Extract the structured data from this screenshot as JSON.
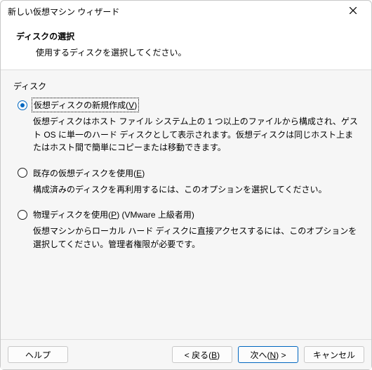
{
  "window": {
    "title": "新しい仮想マシン ウィザード"
  },
  "header": {
    "heading": "ディスクの選択",
    "subheading": "使用するディスクを選択してください。"
  },
  "group": {
    "label": "ディスク"
  },
  "options": [
    {
      "label_pre": "仮想ディスクの新規作成(",
      "accel": "V",
      "label_post": ")",
      "desc": "仮想ディスクはホスト ファイル システム上の 1 つ以上のファイルから構成され、ゲスト OS に単一のハード ディスクとして表示されます。仮想ディスクは同じホスト上またはホスト間で簡単にコピーまたは移動できます。",
      "checked": true
    },
    {
      "label_pre": "既存の仮想ディスクを使用(",
      "accel": "E",
      "label_post": ")",
      "desc": "構成済みのディスクを再利用するには、このオプションを選択してください。",
      "checked": false
    },
    {
      "label_pre": "物理ディスクを使用(",
      "accel": "P",
      "label_post": ") (VMware 上級者用)",
      "desc": "仮想マシンからローカル ハード ディスクに直接アクセスするには、このオプションを選択してください。管理者権限が必要です。",
      "checked": false
    }
  ],
  "footer": {
    "help": "ヘルプ",
    "back_pre": "< 戻る(",
    "back_accel": "B",
    "back_post": ")",
    "next_pre": "次へ(",
    "next_accel": "N",
    "next_post": ") >",
    "cancel": "キャンセル"
  }
}
